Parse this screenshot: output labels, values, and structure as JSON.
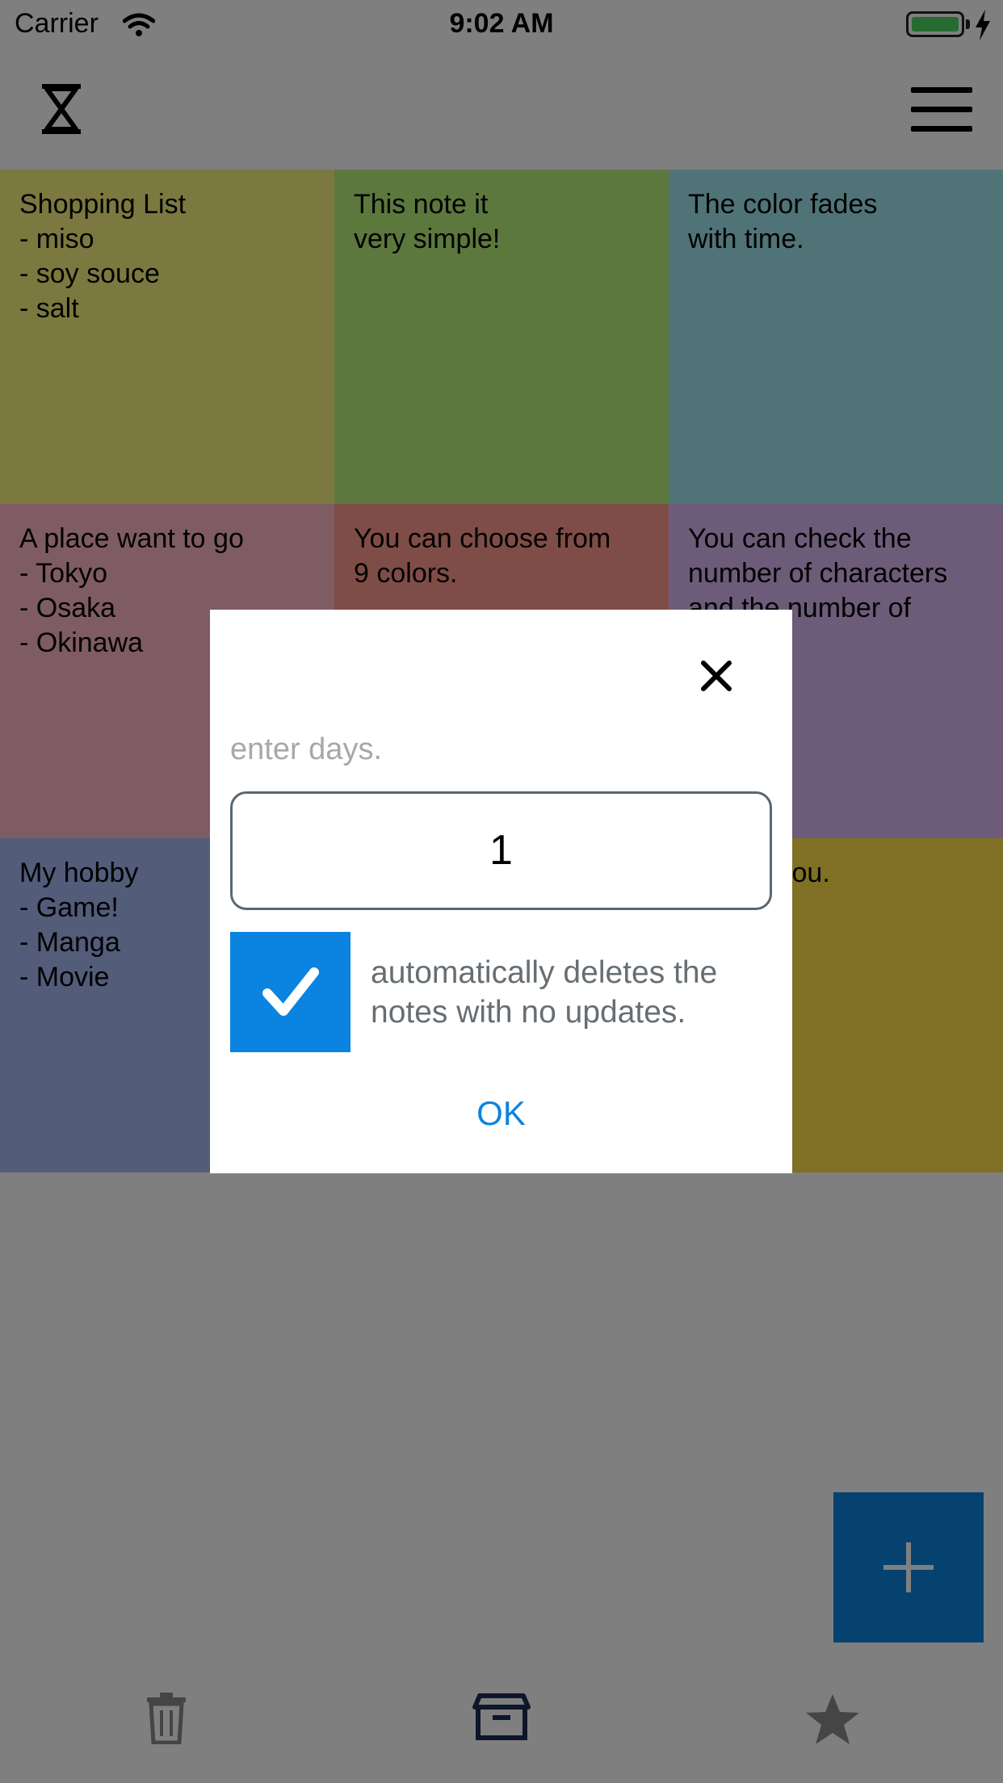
{
  "status_bar": {
    "carrier": "Carrier",
    "time": "9:02 AM"
  },
  "notes": [
    {
      "text": "Shopping List\n- miso\n- soy souce\n- salt",
      "color": "#f6f27e"
    },
    {
      "text": "This note it\nvery simple!",
      "color": "#b8f07a"
    },
    {
      "text": "The color fades\nwith time.",
      "color": "#a0e6f0"
    },
    {
      "text": "A place want to go\n- Tokyo\n- Osaka\n- Okinawa",
      "color": "#ffb8c6"
    },
    {
      "text": "You can choose from\n9 colors.",
      "color": "#ff9a8e"
    },
    {
      "text": "You can check the\nnumber of characters\nand the number of",
      "color": "#d9b8f2"
    },
    {
      "text": "My hobby\n- Game!\n- Manga\n- Movie",
      "color": "#a6b8f2"
    },
    {
      "text": "",
      "color": "#ffffff"
    },
    {
      "text": "...ay to you.",
      "color": "#ffe04a"
    }
  ],
  "dialog": {
    "label": "enter days.",
    "days_value": "1",
    "checkbox_checked": true,
    "checkbox_label": "automatically deletes the notes with no updates.",
    "ok_label": "OK"
  },
  "toolbar": {
    "items": [
      {
        "icon": "trash-icon"
      },
      {
        "icon": "archive-icon",
        "selected": true
      },
      {
        "icon": "star-icon"
      }
    ]
  },
  "colors": {
    "accent": "#0a84e0",
    "overlay": "rgba(0,0,0,0.5)"
  }
}
